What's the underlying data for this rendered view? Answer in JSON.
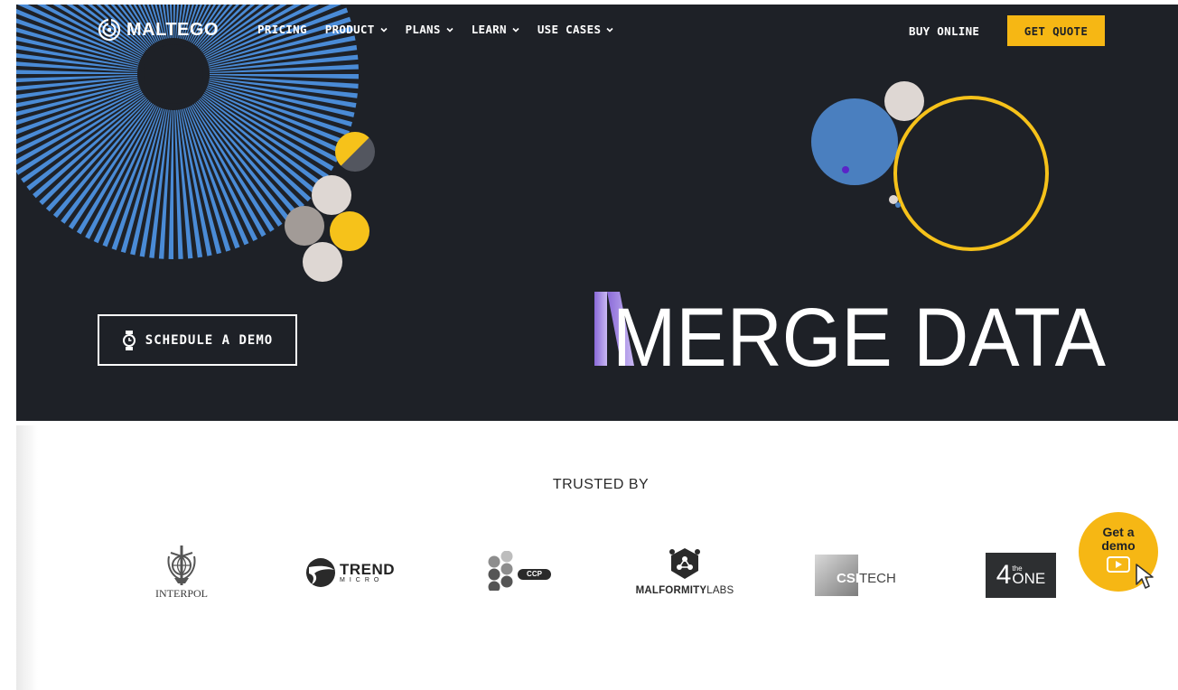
{
  "brand": {
    "name": "MALTEGO"
  },
  "nav": {
    "items": [
      {
        "label": "PRICING",
        "has_dropdown": false
      },
      {
        "label": "PRODUCT",
        "has_dropdown": true
      },
      {
        "label": "PLANS",
        "has_dropdown": true
      },
      {
        "label": "LEARN",
        "has_dropdown": true
      },
      {
        "label": "USE CASES",
        "has_dropdown": true
      }
    ],
    "buy_online": "BUY ONLINE",
    "get_quote": "GET QUOTE"
  },
  "hero": {
    "headline": "MERGE DATA",
    "schedule_demo": "SCHEDULE A DEMO"
  },
  "trusted": {
    "heading": "TRUSTED BY",
    "logos": [
      {
        "name": "INTERPOL"
      },
      {
        "name": "TREND",
        "sub": "MICRO"
      },
      {
        "name": "CCP"
      },
      {
        "name_bold": "MALFORMITY",
        "name_light": "LABS"
      },
      {
        "name_bold": "CSI",
        "name_light": "TECH"
      },
      {
        "num": "4",
        "small": "the",
        "word": "ONE"
      }
    ]
  },
  "demo_badge": {
    "line1": "Get a",
    "line2": "demo"
  },
  "colors": {
    "hero_bg": "#1e2127",
    "accent_yellow": "#f6b714",
    "accent_blue": "#4a8bd6",
    "headline_purple": "#9b7fe0"
  }
}
